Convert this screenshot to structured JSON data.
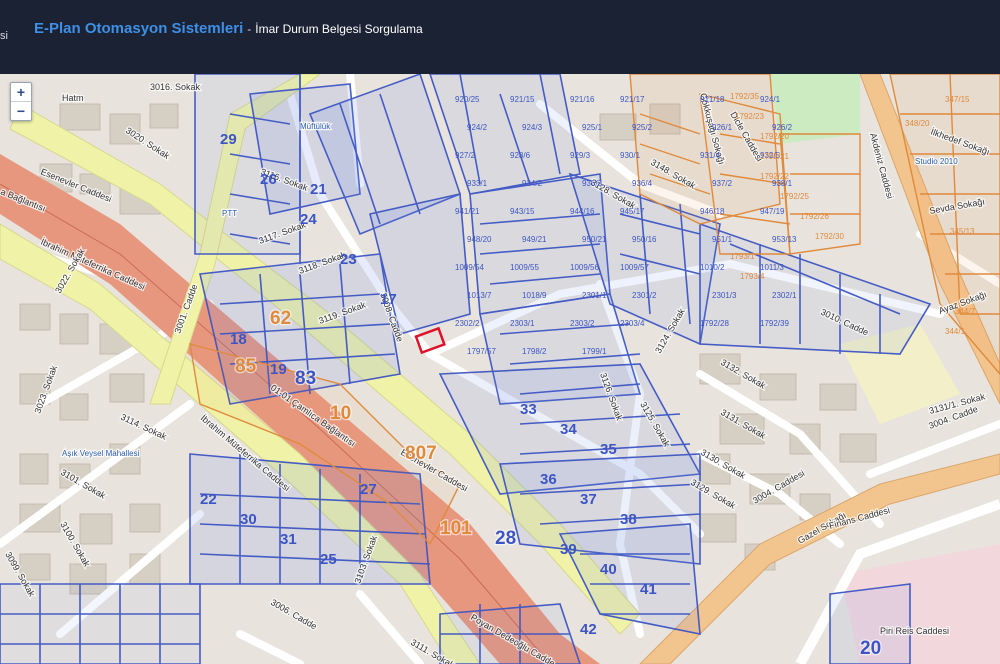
{
  "header": {
    "edge_text": "si",
    "app_title": "E-Plan Otomasyon Sistemleri",
    "separator": "-",
    "page_subtitle": "İmar Durum Belgesi Sorgulama"
  },
  "map_controls": {
    "zoom_in": "+",
    "zoom_out": "−"
  },
  "colors": {
    "header_bg": "#1b2233",
    "title_blue": "#3f8fe6",
    "parcel_blue": "#3d55c4",
    "parcel_orange": "#e08a3c",
    "motorway": "#e89a86",
    "trunk": "#f0f2a8",
    "primary": "#f3c58e",
    "selected_parcel": "#e0112a"
  },
  "streets": [
    "3016. Sokak",
    "Hatm",
    "3020. Sokak",
    "Esenevler Caddesi",
    "a Bağlantısı",
    "İbrahim Müteferrika Caddesi",
    "3022. Sokak",
    "3001. Cadde",
    "3116. Sokak",
    "3117. Sokak",
    "3118. Sokak",
    "3119. Sokak",
    "3008. Cadde",
    "3010. Cadde",
    "3132. Sokak",
    "3131. Sokak",
    "3130. Sokak",
    "3129. Sokak",
    "3128. Sokak",
    "3004. Cadde",
    "3004. Caddesi",
    "Gazel Sokağı",
    "Finans Caddesi",
    "3114. Sokak",
    "3023. Sokak",
    "3101. Sokak",
    "3100. Sokak",
    "3099. Sokak",
    "3103. Sokak",
    "3006. Cadde",
    "3111. Sokak",
    "Piri Reis Caddesi",
    "Ayaz Sokağı",
    "Sevda Sokağı",
    "İlkhedef Sokağı",
    "Akdeniz Caddesi",
    "Gökkuşağı Sokağı",
    "Dicle Caddesi",
    "3148. Sokak",
    "3125. Sokak",
    "3126. Sokak",
    "3124. Sokak",
    "3131/1. Sokak",
    "01-01 Çamlıca Bağlantısı",
    "Esenevler Caddesi",
    "İbrahim Müteferrika Caddesi",
    "Poyan Dedeoğlu Cadde"
  ],
  "pois": [
    "PTT",
    "Aşık Veysel Mahallesi",
    "Müftülük",
    "Studio 2010"
  ],
  "parcel_labels": {
    "large": [
      "20",
      "101",
      "28",
      "807",
      "85",
      "83",
      "10",
      "62"
    ],
    "blue_block": [
      "29",
      "26",
      "24",
      "23",
      "17",
      "18",
      "19",
      "21",
      "22",
      "30",
      "31",
      "25",
      "27",
      "33",
      "34",
      "35",
      "36",
      "37",
      "38",
      "39",
      "40",
      "41",
      "42"
    ],
    "blue_small": [
      "920/25",
      "921/15",
      "921/16",
      "921/17",
      "921/18",
      "924/1",
      "924/2",
      "924/3",
      "925/1",
      "925/2",
      "926/1",
      "926/2",
      "927/2",
      "928/6",
      "929/3",
      "930/1",
      "931/4",
      "932/5",
      "933/1",
      "934/2",
      "935/3",
      "936/4",
      "937/2",
      "938/1",
      "941/21",
      "943/15",
      "944/16",
      "945/17",
      "946/18",
      "947/19",
      "948/20",
      "949/21",
      "950/21",
      "950/16",
      "951/1",
      "953/13",
      "1009/54",
      "1009/55",
      "1009/56",
      "1009/57",
      "1010/2",
      "1011/3",
      "1013/7",
      "1018/9",
      "2301/1",
      "2301/2",
      "2301/3",
      "2302/1",
      "2302/2",
      "2303/1",
      "2303/2",
      "2303/4",
      "1792/28",
      "1792/39",
      "1797/57",
      "1798/2",
      "1799/1"
    ],
    "orange_small": [
      "347/15",
      "348/20",
      "345/13",
      "344/7",
      "344/1",
      "1792/35",
      "1792/23",
      "1792/20",
      "1792/21",
      "1792/22",
      "1792/25",
      "1792/26",
      "1792/30",
      "1793/1",
      "1793/4"
    ]
  }
}
